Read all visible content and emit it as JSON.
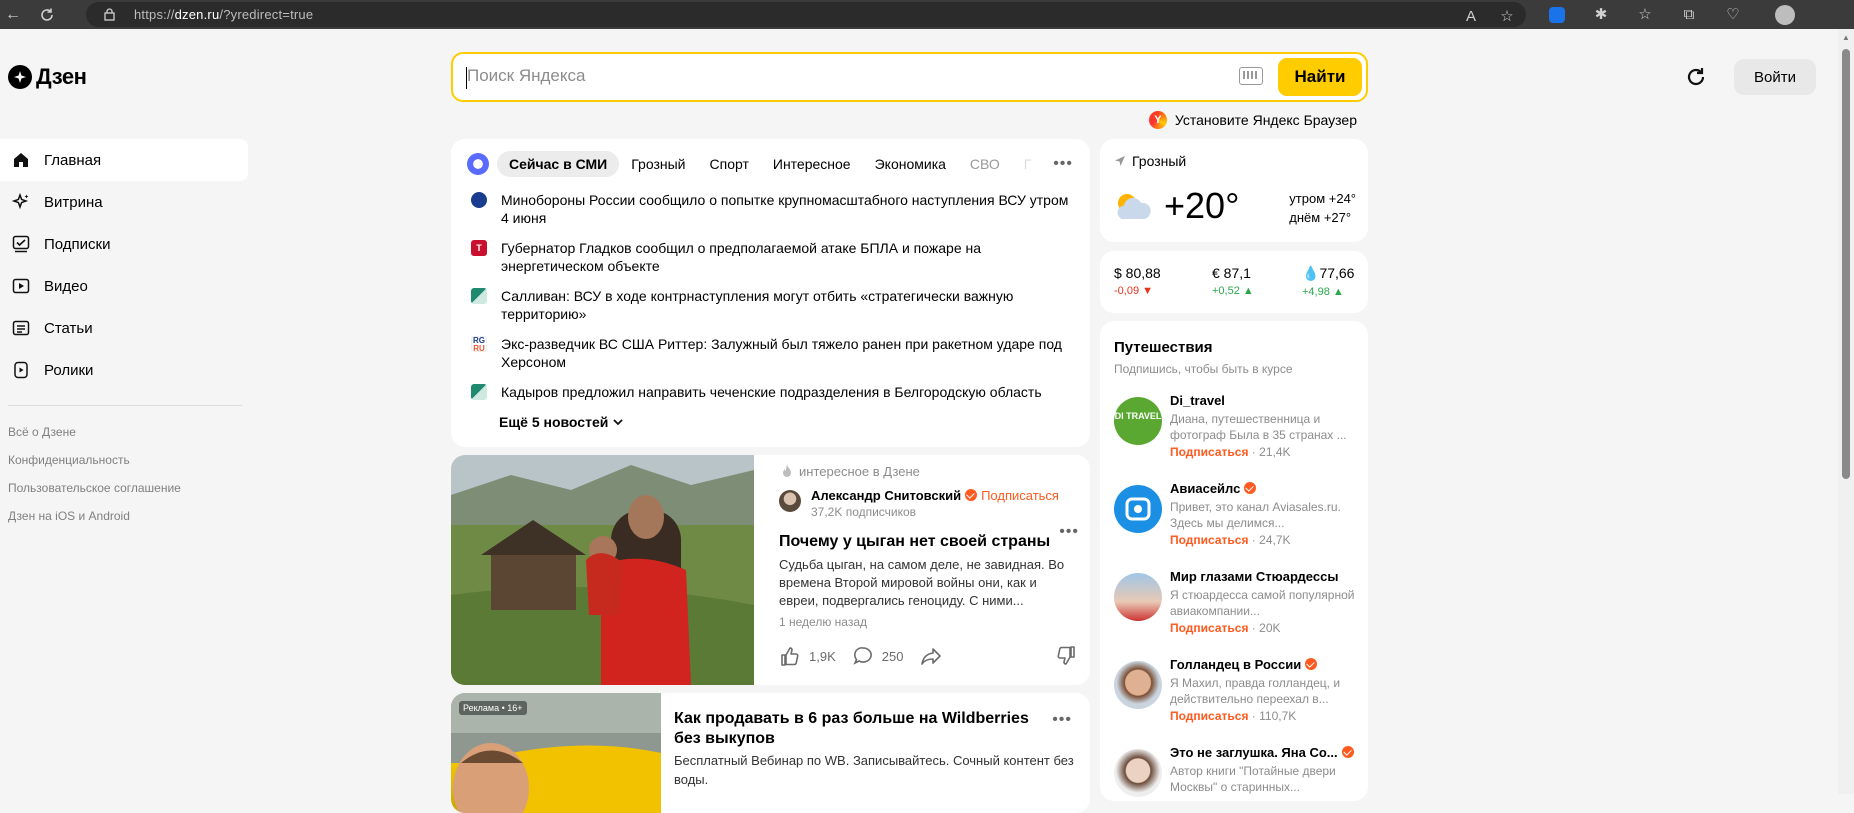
{
  "browser": {
    "url_prefix": "https://",
    "url_host": "dzen.ru",
    "url_rest": "/?yredirect=true"
  },
  "header": {
    "logo_text": "Дзен",
    "search_placeholder": "Поиск Яндекса",
    "search_button": "Найти",
    "browser_promo": "Установите Яндекс Браузер",
    "login_button": "Войти"
  },
  "sidebar": {
    "items": [
      {
        "label": "Главная",
        "icon": "home-icon",
        "active": true
      },
      {
        "label": "Витрина",
        "icon": "sparkle-icon"
      },
      {
        "label": "Подписки",
        "icon": "subscriptions-icon"
      },
      {
        "label": "Видео",
        "icon": "video-icon"
      },
      {
        "label": "Статьи",
        "icon": "articles-icon"
      },
      {
        "label": "Ролики",
        "icon": "clips-icon"
      }
    ],
    "footer_links": [
      "Всё о Дзене",
      "Конфиденциальность",
      "Пользовательское соглашение",
      "Дзен на iOS и Android"
    ]
  },
  "news": {
    "tabs": [
      "Сейчас в СМИ",
      "Грозный",
      "Спорт",
      "Интересное",
      "Экономика",
      "СВО",
      "Г"
    ],
    "items": [
      {
        "text": "Минобороны России сообщило о попытке крупномасштабного наступления ВСУ утром 4 июня",
        "source_icon": "mil-ru-icon"
      },
      {
        "text": "Губернатор Гладков сообщил о предполагаемой атаке БПЛА и пожаре на энергетическом объекте",
        "source_icon": "t-media-icon"
      },
      {
        "text": "Салливан: ВСУ в ходе контрнаступления могут отбить «стратегически важную территорию»",
        "source_icon": "media-green-icon"
      },
      {
        "text": "Экс-разведчик ВС США Риттер: Залужный был тяжело ранен при ракетном ударе под Херсоном",
        "source_icon": "rg-ru-icon"
      },
      {
        "text": "Кадыров предложил направить чеченские подразделения в Белгородскую область",
        "source_icon": "media-green-icon"
      }
    ],
    "more_label": "Ещё 5 новостей"
  },
  "article": {
    "context": "интересное в Дзене",
    "author": "Александр Снитовский",
    "subscribe": "Подписаться",
    "subscribers": "37,2K подписчиков",
    "title": "Почему у цыган нет своей страны",
    "description": "Судьба цыган, на самом деле, не завидная. Во времена Второй мировой войны они, как и евреи, подвергались геноциду. С ними...",
    "time": "1 неделю назад",
    "likes": "1,9K",
    "comments": "250"
  },
  "ad": {
    "label": "Реклама • 16+",
    "title": "Как продавать в 6 раз больше на Wildberries без выкупов",
    "description": "Бесплатный Вебинар по WB. Записывайтесь. Сочный контент без воды."
  },
  "weather": {
    "city": "Грозный",
    "temp": "+20°",
    "morning": "утром +24°",
    "day": "днём +27°"
  },
  "rates": [
    {
      "value": "$ 80,88",
      "change": "-0,09",
      "dir": "down"
    },
    {
      "value": "€ 87,1",
      "change": "+0,52",
      "dir": "up"
    },
    {
      "value": "77,66",
      "change": "+4,98",
      "dir": "up"
    }
  ],
  "travel": {
    "title": "Путешествия",
    "subtitle": "Подпишись, чтобы быть в курсе",
    "avatar_text": "DI TRAVEL",
    "subscribe": "Подписаться",
    "channels": [
      {
        "name": "Di_travel",
        "verified": false,
        "desc": "Диана, путешественница и фотограф Была в 35 странах ...",
        "subs": "21,4K"
      },
      {
        "name": "Авиасейлс",
        "verified": true,
        "desc": "Привет, это канал Aviasales.ru. Здесь мы делимся...",
        "subs": "24,7K"
      },
      {
        "name": "Мир глазами Стюардессы",
        "verified": false,
        "desc": "Я стюардесса самой популярной авиакомпании...",
        "subs": "20K"
      },
      {
        "name": "Голландец в России",
        "verified": true,
        "desc": "Я Махил, правда голландец, и действительно переехал в...",
        "subs": "110,7K"
      },
      {
        "name": "Это не заглушка. Яна Со...",
        "verified": true,
        "desc": "Автор книги \"Потайные двери Москвы\" о старинных...",
        "subs": ""
      }
    ]
  },
  "colors": {
    "accent_yellow": "#ffcc00",
    "subscribe_orange": "#ff5a1f",
    "down_red": "#e5341b",
    "up_green": "#2ba84a"
  }
}
